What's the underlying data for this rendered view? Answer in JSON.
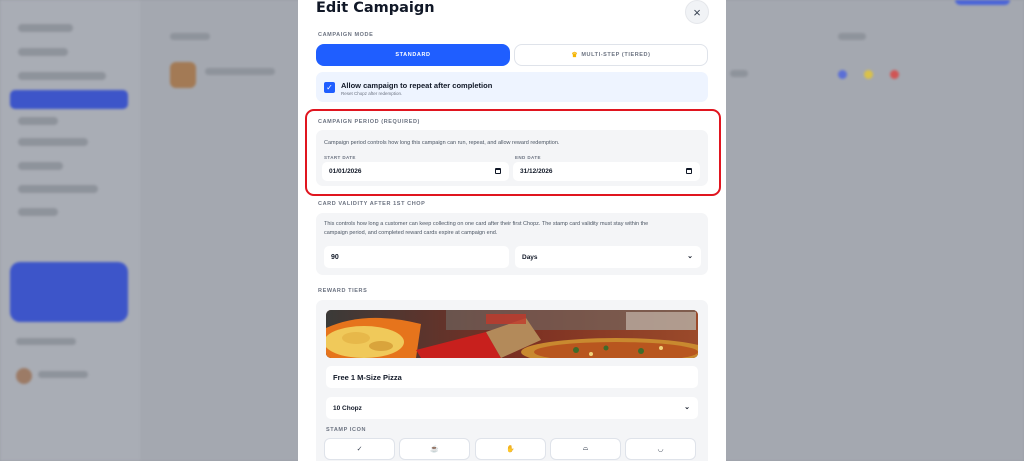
{
  "modal": {
    "title": "Edit Campaign",
    "close_symbol": "×"
  },
  "campaign_mode": {
    "label": "CAMPAIGN MODE",
    "options": [
      {
        "label": "STANDARD",
        "selected": true
      },
      {
        "label": "MULTI-STEP (TIERED)",
        "icon": "crown-icon",
        "selected": false
      }
    ]
  },
  "repeat": {
    "checked": true,
    "title": "Allow campaign to repeat after completion",
    "subtitle": "Reset Chopz after redemption."
  },
  "period": {
    "label": "CAMPAIGN PERIOD (REQUIRED)",
    "description": "Campaign period controls how long this campaign can run, repeat, and allow reward redemption.",
    "start_label": "START DATE",
    "start_value": "01/01/2026",
    "end_label": "END DATE",
    "end_value": "31/12/2026",
    "highlight_color": "#e0151f"
  },
  "validity": {
    "label": "CARD VALIDITY AFTER 1ST CHOP",
    "description_line1": "This controls how long a customer can keep collecting on one card after their first Chopz. The stamp card validity must stay within the",
    "description_line2": "campaign period, and completed reward cards expire at campaign end.",
    "amount": "90",
    "unit": "Days"
  },
  "reward_tiers": {
    "label": "REWARD TIERS",
    "tier_name": "Free 1 M-Size Pizza",
    "chopz_required": "10 Chopz",
    "stamp_icon_label": "STAMP ICON",
    "stamp_icons": [
      "check-icon",
      "cup-icon",
      "hand-icon",
      "burger-icon",
      "bowl-icon"
    ],
    "stamp_glyphs": [
      "✓",
      "☕",
      "✋",
      "⌓",
      "◡"
    ]
  },
  "colors": {
    "primary": "#1f5eff",
    "overlay": "#9a9ea6"
  }
}
